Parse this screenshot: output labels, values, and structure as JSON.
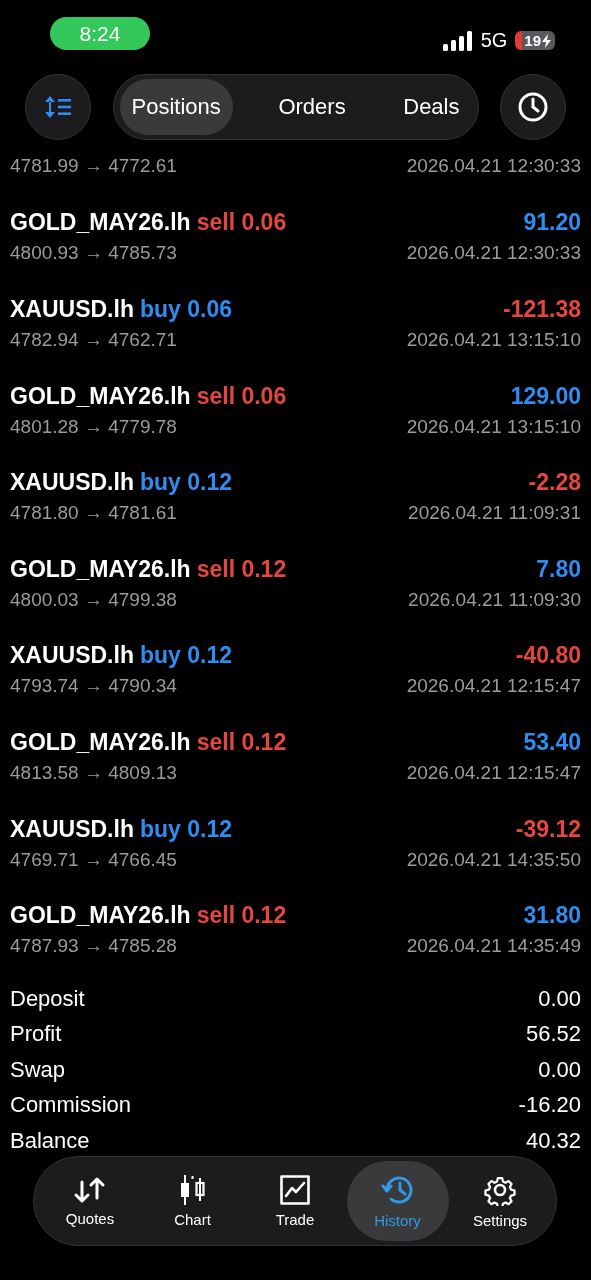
{
  "status_bar": {
    "time": "8:24",
    "network": "5G",
    "battery": "19"
  },
  "segments": [
    {
      "label": "Positions",
      "selected": true
    },
    {
      "label": "Orders",
      "selected": false
    },
    {
      "label": "Deals",
      "selected": false
    }
  ],
  "deals": [
    {
      "prices": "4781.99 → 4772.61",
      "time": "2026.04.21 12:30:33"
    },
    {
      "symbol": "GOLD_MAY26.lh",
      "side": "sell",
      "volume": "0.06",
      "prices": "4800.93 → 4785.73",
      "time": "2026.04.21 12:30:33",
      "profit": "91.20",
      "negative": false
    },
    {
      "symbol": "XAUUSD.lh",
      "side": "buy",
      "volume": "0.06",
      "prices": "4782.94 → 4762.71",
      "time": "2026.04.21 13:15:10",
      "profit": "-121.38",
      "negative": true
    },
    {
      "symbol": "GOLD_MAY26.lh",
      "side": "sell",
      "volume": "0.06",
      "prices": "4801.28 → 4779.78",
      "time": "2026.04.21 13:15:10",
      "profit": "129.00",
      "negative": false
    },
    {
      "symbol": "XAUUSD.lh",
      "side": "buy",
      "volume": "0.12",
      "prices": "4781.80 → 4781.61",
      "time": "2026.04.21 11:09:31",
      "profit": "-2.28",
      "negative": true
    },
    {
      "symbol": "GOLD_MAY26.lh",
      "side": "sell",
      "volume": "0.12",
      "prices": "4800.03 → 4799.38",
      "time": "2026.04.21 11:09:30",
      "profit": "7.80",
      "negative": false
    },
    {
      "symbol": "XAUUSD.lh",
      "side": "buy",
      "volume": "0.12",
      "prices": "4793.74 → 4790.34",
      "time": "2026.04.21 12:15:47",
      "profit": "-40.80",
      "negative": true
    },
    {
      "symbol": "GOLD_MAY26.lh",
      "side": "sell",
      "volume": "0.12",
      "prices": "4813.58 → 4809.13",
      "time": "2026.04.21 12:15:47",
      "profit": "53.40",
      "negative": false
    },
    {
      "symbol": "XAUUSD.lh",
      "side": "buy",
      "volume": "0.12",
      "prices": "4769.71 → 4766.45",
      "time": "2026.04.21 14:35:50",
      "profit": "-39.12",
      "negative": true
    },
    {
      "symbol": "GOLD_MAY26.lh",
      "side": "sell",
      "volume": "0.12",
      "prices": "4787.93 → 4785.28",
      "time": "2026.04.21 14:35:49",
      "profit": "31.80",
      "negative": false
    }
  ],
  "summary": [
    {
      "label": "Deposit",
      "value": "0.00"
    },
    {
      "label": "Profit",
      "value": "56.52"
    },
    {
      "label": "Swap",
      "value": "0.00"
    },
    {
      "label": "Commission",
      "value": "-16.20"
    },
    {
      "label": "Balance",
      "value": "40.32"
    }
  ],
  "tab_bar": [
    {
      "label": "Quotes",
      "kind": "quotes",
      "selected": false
    },
    {
      "label": "Chart",
      "kind": "chart",
      "selected": false
    },
    {
      "label": "Trade",
      "kind": "trade",
      "selected": false
    },
    {
      "label": "History",
      "kind": "history",
      "selected": true
    },
    {
      "label": "Settings",
      "kind": "settings",
      "selected": false
    }
  ]
}
